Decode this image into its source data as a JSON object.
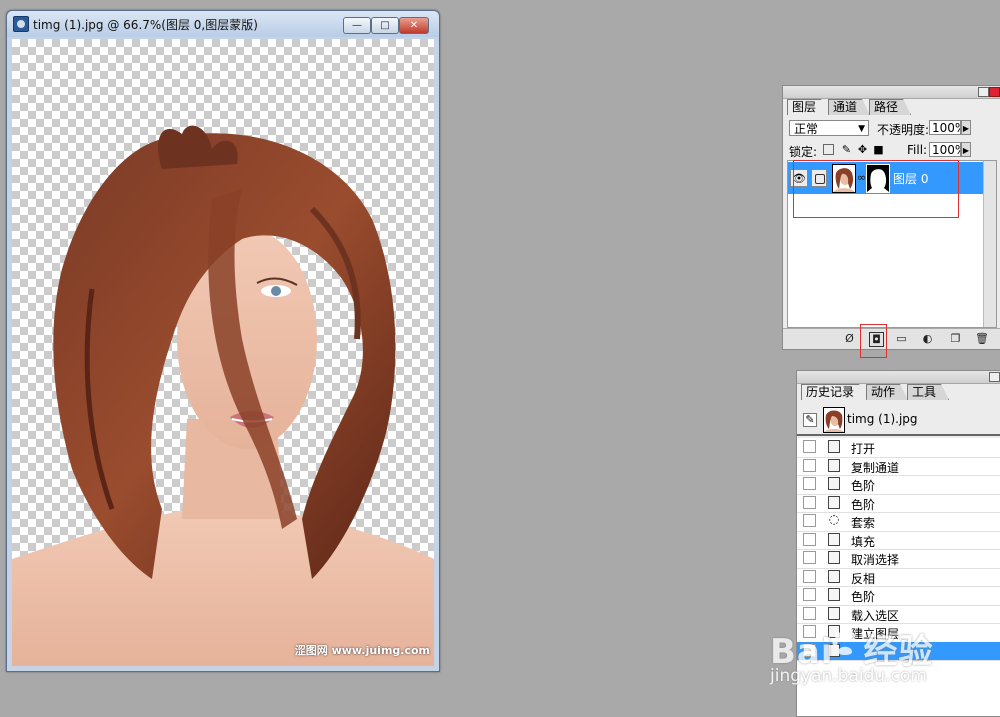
{
  "document_window": {
    "title": "timg (1).jpg @ 66.7%(图层 0,图层蒙版)",
    "minimize_symbol": "—",
    "maximize_symbol": "□",
    "close_symbol": "✕",
    "watermark": "涩图网 www.juimg.com"
  },
  "layers_panel": {
    "tabs": [
      {
        "label": "图层",
        "active": true
      },
      {
        "label": "通道",
        "active": false
      },
      {
        "label": "路径",
        "active": false
      }
    ],
    "blend_mode": "正常",
    "opacity_label": "不透明度:",
    "opacity_value": "100%",
    "lock_label": "锁定:",
    "fill_label": "Fill:",
    "fill_value": "100%",
    "layer": {
      "name": "图层 0",
      "eye_icon": "👁",
      "chain_icon": "∞"
    },
    "bottom_icons": [
      "link-layers-icon",
      "add-mask-icon",
      "new-group-icon",
      "adjustment-layer-icon",
      "new-layer-icon",
      "trash-icon"
    ],
    "accent_color": "#3399ff",
    "highlight_color": "#e03030"
  },
  "history_panel": {
    "tabs": [
      {
        "label": "历史记录",
        "active": true
      },
      {
        "label": "动作",
        "active": false
      },
      {
        "label": "工具",
        "active": false
      }
    ],
    "snapshot_name": "timg (1).jpg",
    "items": [
      {
        "label": "打开",
        "selected": false
      },
      {
        "label": "复制通道",
        "selected": false
      },
      {
        "label": "色阶",
        "selected": false
      },
      {
        "label": "色阶",
        "selected": false
      },
      {
        "label": "套索",
        "selected": false
      },
      {
        "label": "填充",
        "selected": false
      },
      {
        "label": "取消选择",
        "selected": false
      },
      {
        "label": "反相",
        "selected": false
      },
      {
        "label": "色阶",
        "selected": false
      },
      {
        "label": "载入选区",
        "selected": false
      },
      {
        "label": "建立图层",
        "selected": false
      },
      {
        "label": "",
        "selected": true
      }
    ]
  },
  "watermark": {
    "logo_left": "Bai",
    "logo_right": "经验",
    "url": "jingyan.baidu.com"
  }
}
